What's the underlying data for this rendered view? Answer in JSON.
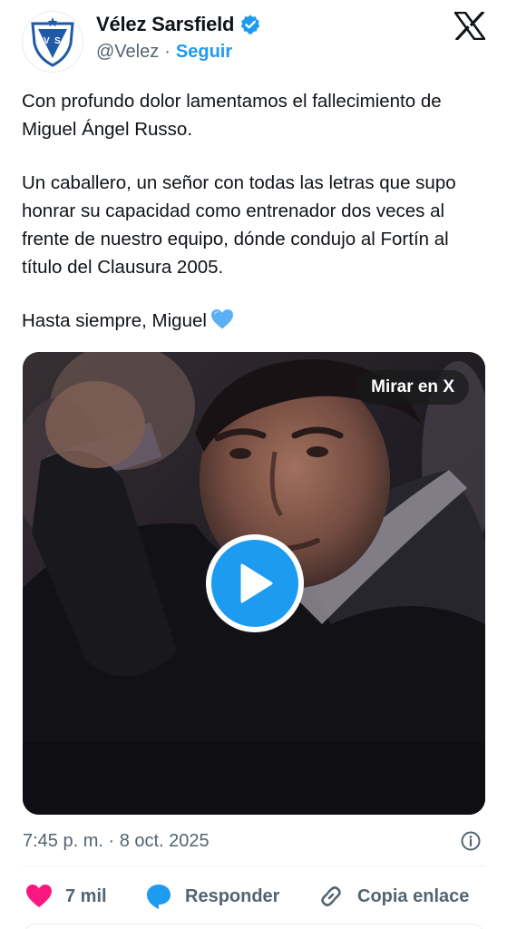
{
  "author": {
    "name": "Vélez Sarsfield",
    "handle": "@Velez",
    "separator": "·",
    "follow_label": "Seguir",
    "logo_text": "V S"
  },
  "tweet": {
    "paragraph_1": "Con profundo dolor lamentamos el fallecimiento de Miguel Ángel Russo.",
    "paragraph_2": "Un caballero, un señor con todas las letras que supo honrar su capacidad como entrenador dos veces al frente de nuestro equipo, dónde condujo al Fortín al título del Clausura 2005.",
    "paragraph_3": "Hasta siempre, Miguel",
    "emoji": "light-blue-heart"
  },
  "media": {
    "watch_label": "Mirar en X",
    "type": "video"
  },
  "meta": {
    "timestamp": "7:45 p. m. · 8 oct. 2025"
  },
  "actions": {
    "like_count": "7 mil",
    "reply_label": "Responder",
    "copy_label": "Copia enlace"
  },
  "colors": {
    "accent": "#1d9bf0",
    "like": "#f91880",
    "text": "#0f1419",
    "secondary": "#536471",
    "club_blue": "#1f5aa6"
  }
}
